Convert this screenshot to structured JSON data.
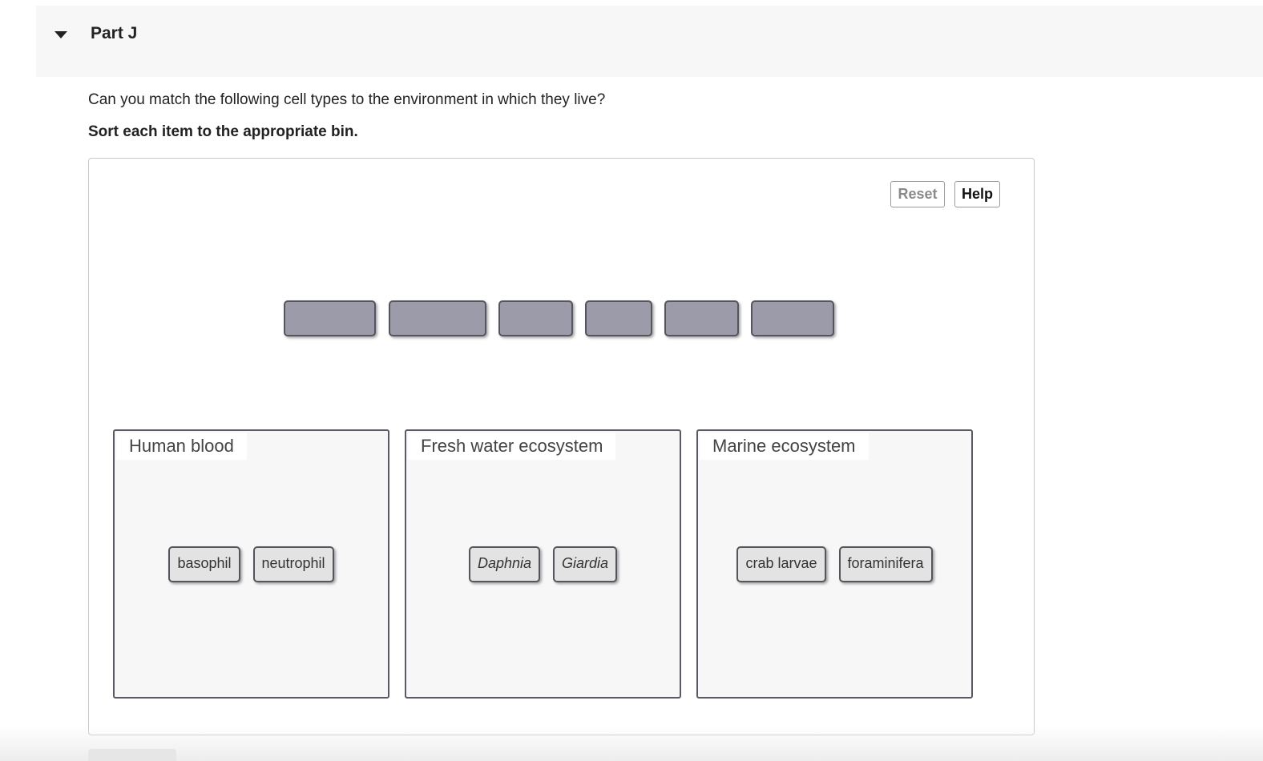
{
  "part": {
    "title": "Part J"
  },
  "question": {
    "text": "Can you match the following cell types to the environment in which they live?",
    "instruction": "Sort each item to the appropriate bin."
  },
  "toolbar": {
    "reset_label": "Reset",
    "help_label": "Help"
  },
  "bins": [
    {
      "label": "Human blood",
      "items": [
        {
          "text": "basophil",
          "italic": false
        },
        {
          "text": "neutrophil",
          "italic": false
        }
      ]
    },
    {
      "label": "Fresh water ecosystem",
      "items": [
        {
          "text": "Daphnia",
          "italic": true
        },
        {
          "text": "Giardia",
          "italic": true
        }
      ]
    },
    {
      "label": "Marine ecosystem",
      "items": [
        {
          "text": "crab larvae",
          "italic": false
        },
        {
          "text": "foraminifera",
          "italic": false
        }
      ]
    }
  ],
  "empty_slot_count": 6,
  "colors": {
    "header_bg": "#f7f7f7",
    "slot_fill": "#9c9ba9",
    "chip_fill": "#e3e3e3",
    "bin_fill": "#f7f7f7",
    "border_dark": "#55555e"
  }
}
